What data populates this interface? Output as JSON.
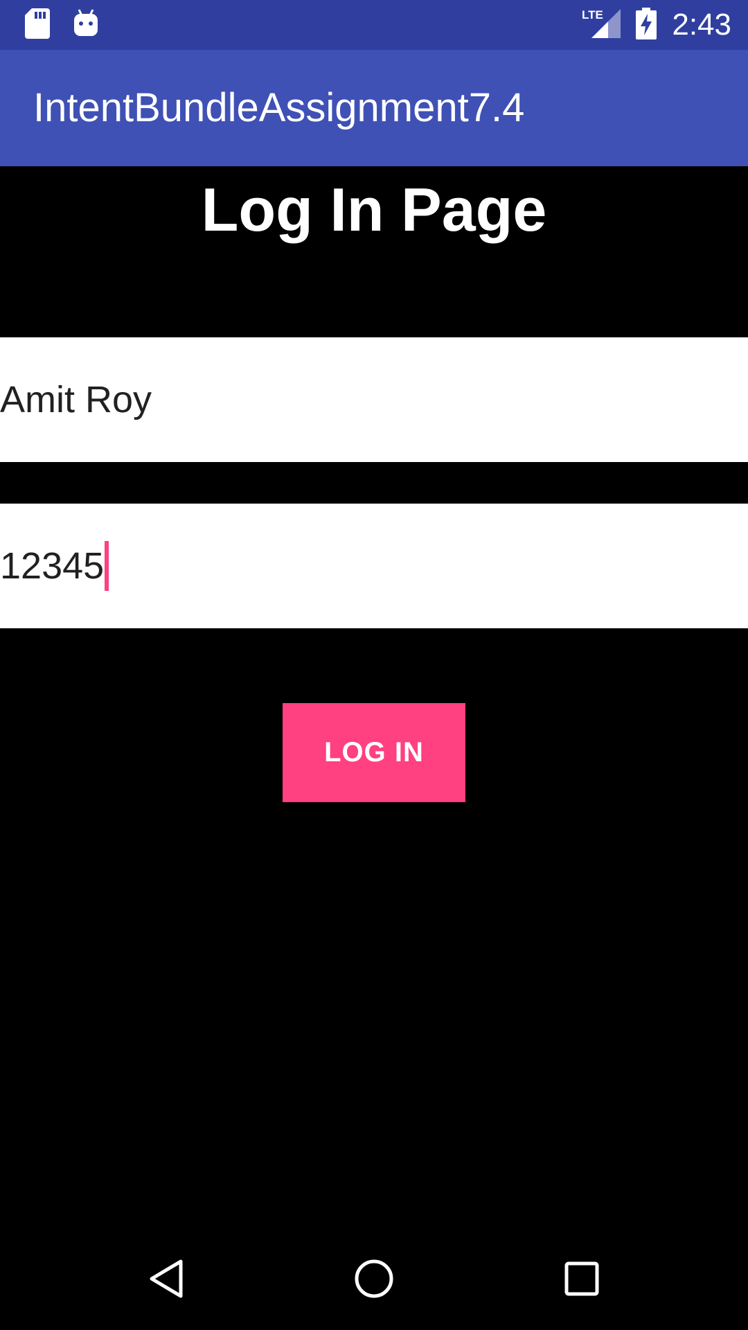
{
  "status_bar": {
    "time": "2:43",
    "network_label": "LTE",
    "icons": [
      "sd-card-icon",
      "android-debug-icon",
      "lte-signal-icon",
      "battery-charging-icon"
    ]
  },
  "app_bar": {
    "title": "IntentBundleAssignment7.4"
  },
  "page": {
    "heading": "Log In Page"
  },
  "form": {
    "username_value": "Amit Roy",
    "password_value": "12345",
    "login_label": "LOG IN"
  },
  "nav_bar": {
    "icons": [
      "back-icon",
      "home-icon",
      "recents-icon"
    ]
  },
  "colors": {
    "status_bar": "#303f9f",
    "app_bar": "#3f51b5",
    "accent": "#ff4081",
    "background": "#000000"
  }
}
